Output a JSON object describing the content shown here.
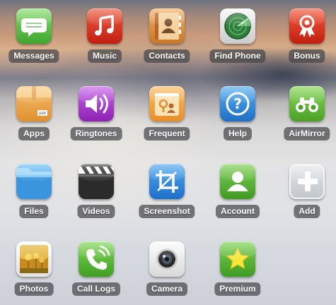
{
  "apps": [
    {
      "label": "Messages",
      "icon": "messages-icon",
      "color": "#5cc24a"
    },
    {
      "label": "Music",
      "icon": "music-icon",
      "color": "#d8311d"
    },
    {
      "label": "Contacts",
      "icon": "contacts-icon",
      "color": "#d98a3a"
    },
    {
      "label": "Find Phone",
      "icon": "radar-icon",
      "color": "#3f8e46"
    },
    {
      "label": "Bonus",
      "icon": "gift-icon",
      "color": "#d83a23"
    },
    {
      "label": "Apps",
      "icon": "app-box-icon",
      "color": "#e8a24b"
    },
    {
      "label": "Ringtones",
      "icon": "speaker-icon",
      "color": "#a23ac8"
    },
    {
      "label": "Frequent",
      "icon": "frequent-folder-icon",
      "color": "#f0a24a"
    },
    {
      "label": "Help",
      "icon": "help-icon",
      "color": "#2e86d8"
    },
    {
      "label": "AirMirror",
      "icon": "binoculars-icon",
      "color": "#62b93a"
    },
    {
      "label": "Files",
      "icon": "folder-icon",
      "color": "#3a95de"
    },
    {
      "label": "Videos",
      "icon": "clapperboard-icon",
      "color": "#333333"
    },
    {
      "label": "Screenshot",
      "icon": "crop-icon",
      "color": "#2b88dc"
    },
    {
      "label": "Account",
      "icon": "account-icon",
      "color": "#58b33a"
    },
    {
      "label": "Add",
      "icon": "plus-icon",
      "color": "#cfd3d7"
    },
    {
      "label": "Photos",
      "icon": "photo-icon",
      "color": "#d9a22a"
    },
    {
      "label": "Call Logs",
      "icon": "phone-icon",
      "color": "#58b83a"
    },
    {
      "label": "Camera",
      "icon": "camera-icon",
      "color": "#e8e8e8"
    },
    {
      "label": "Premium",
      "icon": "star-icon",
      "color": "#58b33a"
    }
  ]
}
